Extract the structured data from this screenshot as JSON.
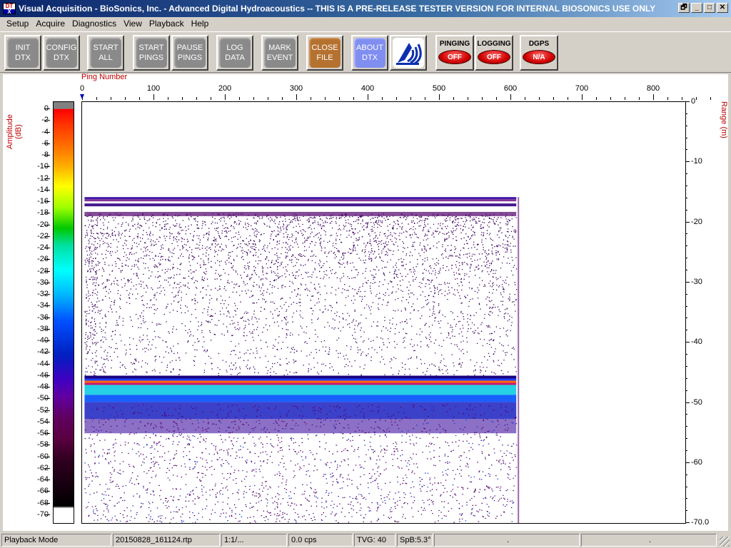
{
  "window": {
    "title": "Visual Acquisition  -  BioSonics, Inc.  -  Advanced Digital Hydroacoustics  -- THIS IS A PRE-RELEASE TESTER VERSION FOR INTERNAL BIOSONICS USE ONLY",
    "icon_top": "DT",
    "icon_bottom": "X",
    "controls": [
      "🗗",
      "_",
      "□",
      "✕"
    ]
  },
  "menu": [
    "Setup",
    "Acquire",
    "Diagnostics",
    "View",
    "Playback",
    "Help"
  ],
  "toolbar": {
    "buttons": [
      {
        "label": "INIT\nDTX",
        "style": "gray"
      },
      {
        "label": "CONFIG\nDTX",
        "style": "gray"
      },
      {
        "label": "START\nALL",
        "style": "gray"
      },
      {
        "label": "START\nPINGS",
        "style": "gray"
      },
      {
        "label": "PAUSE\nPINGS",
        "style": "gray"
      },
      {
        "label": "LOG\nDATA",
        "style": "gray"
      },
      {
        "label": "MARK\nEVENT",
        "style": "gray"
      },
      {
        "label": "CLOSE\nFILE",
        "style": "brown"
      },
      {
        "label": "ABOUT\nDTX",
        "style": "blue"
      }
    ],
    "logo": "biosonics-logo-icon",
    "status": [
      {
        "label": "PINGING",
        "state": "OFF"
      },
      {
        "label": "LOGGING",
        "state": "OFF"
      },
      {
        "label": "DGPS",
        "state": "N/A"
      }
    ]
  },
  "plot": {
    "x_axis_label": "Ping Number",
    "left_axis_label": "Amplitude (dB)",
    "right_axis_label": "Range (m)",
    "x_ticks": [
      "0",
      "100",
      "200",
      "300",
      "400",
      "500",
      "600",
      "700",
      "800"
    ],
    "range_ticks": [
      "0",
      "-10",
      "-20",
      "-30",
      "-40",
      "-50",
      "-60",
      "-70.0"
    ],
    "amplitude_ticks": [
      "0",
      "-2",
      "-4",
      "-6",
      "-8",
      "-10",
      "-12",
      "-14",
      "-16",
      "-18",
      "-20",
      "-22",
      "-24",
      "-26",
      "-28",
      "-30",
      "-32",
      "-34",
      "-36",
      "-38",
      "-40",
      "-42",
      "-44",
      "-46",
      "-48",
      "-50",
      "-52",
      "-54",
      "-56",
      "-58",
      "-60",
      "-62",
      "-64",
      "-66",
      "-68",
      "-70"
    ],
    "x_range": [
      0,
      850
    ],
    "range_m": [
      0,
      70
    ],
    "amplitude_db": [
      0,
      -70
    ],
    "pings_recorded": 612,
    "layers": [
      {
        "name": "surface",
        "top_m": 15.8,
        "bottom_m": 18.5
      },
      {
        "name": "bottom",
        "top_m": 45.5,
        "bottom_m": 55
      }
    ]
  },
  "statusbar": [
    "Playback Mode",
    "20150828_161124.rtp",
    "1:1/...",
    "0.0 cps",
    "TVG: 40",
    "SpB:5.3°",
    ".",
    "."
  ]
}
